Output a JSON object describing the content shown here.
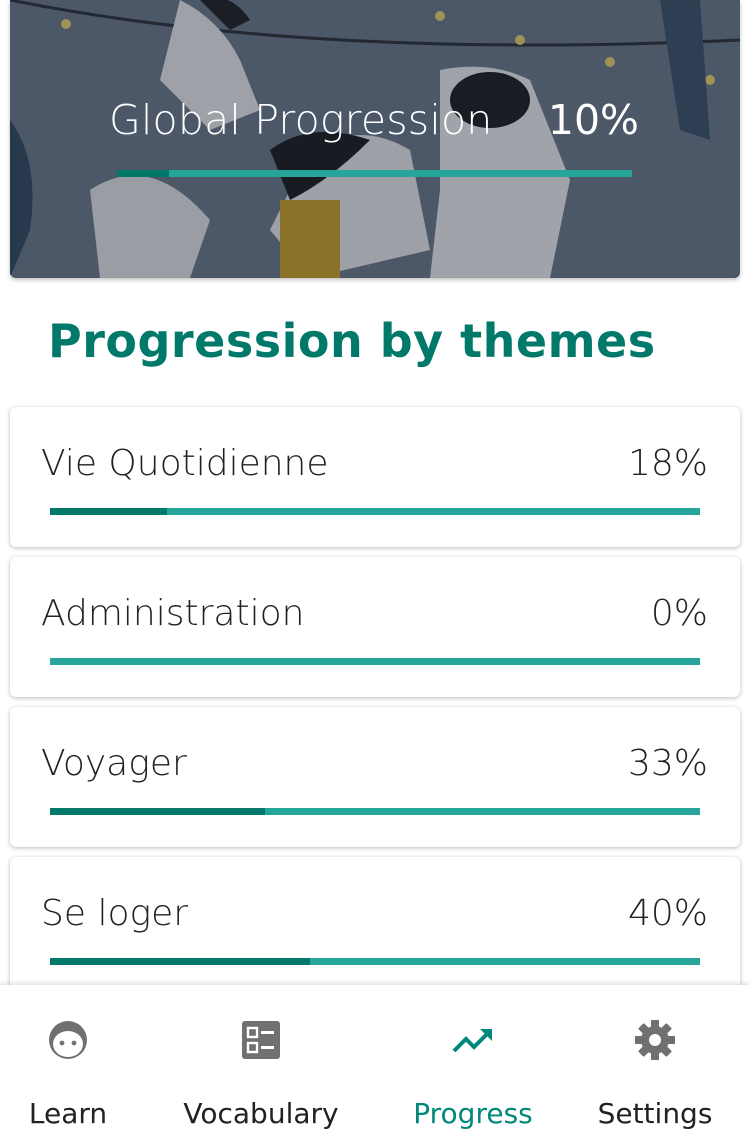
{
  "global": {
    "title": "Global Progression",
    "percent_label": "10%",
    "progress": 0.1
  },
  "section": {
    "title": "Progression by themes"
  },
  "themes": [
    {
      "name": "Vie Quotidienne",
      "percent_label": "18%",
      "progress": 0.18
    },
    {
      "name": "Administration",
      "percent_label": "0%",
      "progress": 0.0
    },
    {
      "name": "Voyager",
      "percent_label": "33%",
      "progress": 0.33
    },
    {
      "name": "Se loger",
      "percent_label": "40%",
      "progress": 0.4
    }
  ],
  "nav": {
    "items": [
      {
        "label": "Learn",
        "icon": "face-icon",
        "active": false
      },
      {
        "label": "Vocabulary",
        "icon": "list-icon",
        "active": false
      },
      {
        "label": "Progress",
        "icon": "trending-up-icon",
        "active": true
      },
      {
        "label": "Settings",
        "icon": "gear-icon",
        "active": false
      }
    ]
  },
  "colors": {
    "accent_dark": "#00796b",
    "accent_light": "#26a69a",
    "active_nav": "#00897b",
    "inactive_icon": "#707070"
  }
}
